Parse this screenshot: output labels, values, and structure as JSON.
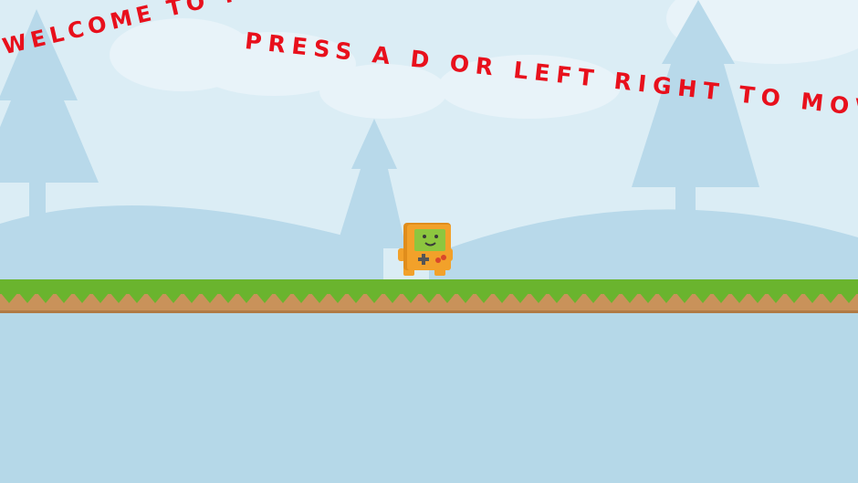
{
  "hud": {
    "welcome_text": "WELCOME TO THE",
    "instructions_text": "PRESS A D OR LEFT RIGHT TO MOVE"
  },
  "colors": {
    "sky": "#dbedf5",
    "cloud": "#e8f3f9",
    "scenery": "#b8d9ea",
    "grass": "#6ab42e",
    "dirt": "#c9925a",
    "water": "#b5d8e8",
    "text": "#e8101c",
    "player_body": "#f2a12a",
    "player_screen": "#8dc63f"
  },
  "icons": {
    "player": "gameboy-character-icon"
  }
}
